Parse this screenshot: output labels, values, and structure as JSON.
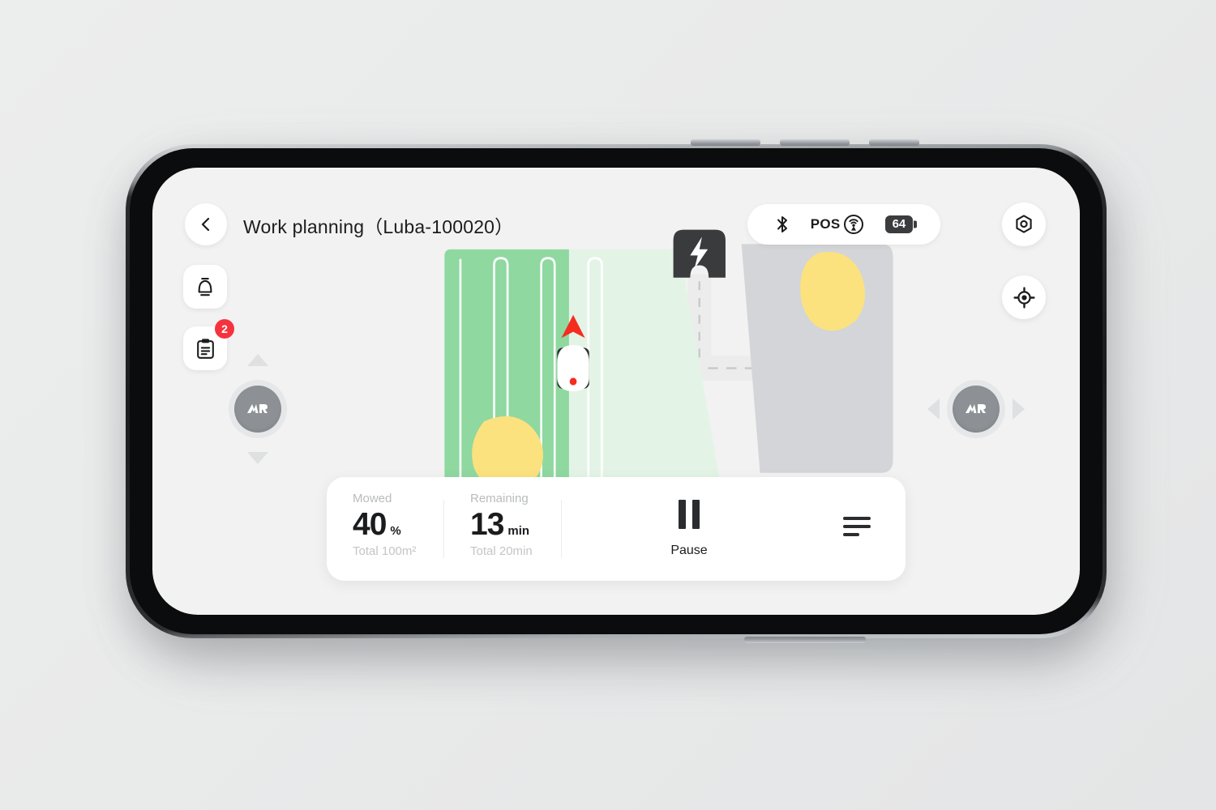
{
  "app": {
    "page_title": "Work planning（Luba-100020）",
    "device_name": "Luba-100020"
  },
  "topbar": {
    "back_icon": "chevron-left-icon",
    "bluetooth_icon": "bluetooth-icon",
    "pos_label": "POS",
    "pos_icon": "gps-signal-icon",
    "battery_level": "64",
    "settings_icon": "hexagon-gear-icon",
    "locate_icon": "crosshair-target-icon"
  },
  "left_rail": {
    "notification_icon": "bell-icon",
    "task_icon": "clipboard-icon",
    "task_badge_count": "2"
  },
  "joysticks": {
    "left": {
      "name": "forward-backward-joystick",
      "knob_icon": "mammotion-logo-icon",
      "up_icon": "arrow-up-icon",
      "down_icon": "arrow-down-icon"
    },
    "right": {
      "name": "steering-joystick",
      "knob_icon": "mammotion-logo-icon",
      "left_icon": "arrow-left-icon",
      "right_icon": "arrow-right-icon"
    }
  },
  "map": {
    "mowed_zone_color": "#8fd8a0",
    "unmowed_zone_color": "#e3f4e7",
    "obstacle_color": "#fbe27e",
    "secondary_zone_color": "#d3d5d8",
    "road_color": "#ececec",
    "dock_color": "#3a3b3d",
    "robot_heading_color": "#f52d1f",
    "dock_icon": "charging-dock-icon",
    "robot_icon": "robot-mower-icon",
    "heading_icon": "direction-arrow-icon"
  },
  "status_card": {
    "mowed": {
      "label": "Mowed",
      "value": "40",
      "unit": "%",
      "total": "Total 100m²"
    },
    "remaining": {
      "label": "Remaining",
      "value": "13",
      "unit": "min",
      "total": "Total 20min"
    },
    "pause": {
      "label": "Pause",
      "icon": "pause-icon"
    },
    "list": {
      "icon": "list-lines-icon"
    }
  }
}
